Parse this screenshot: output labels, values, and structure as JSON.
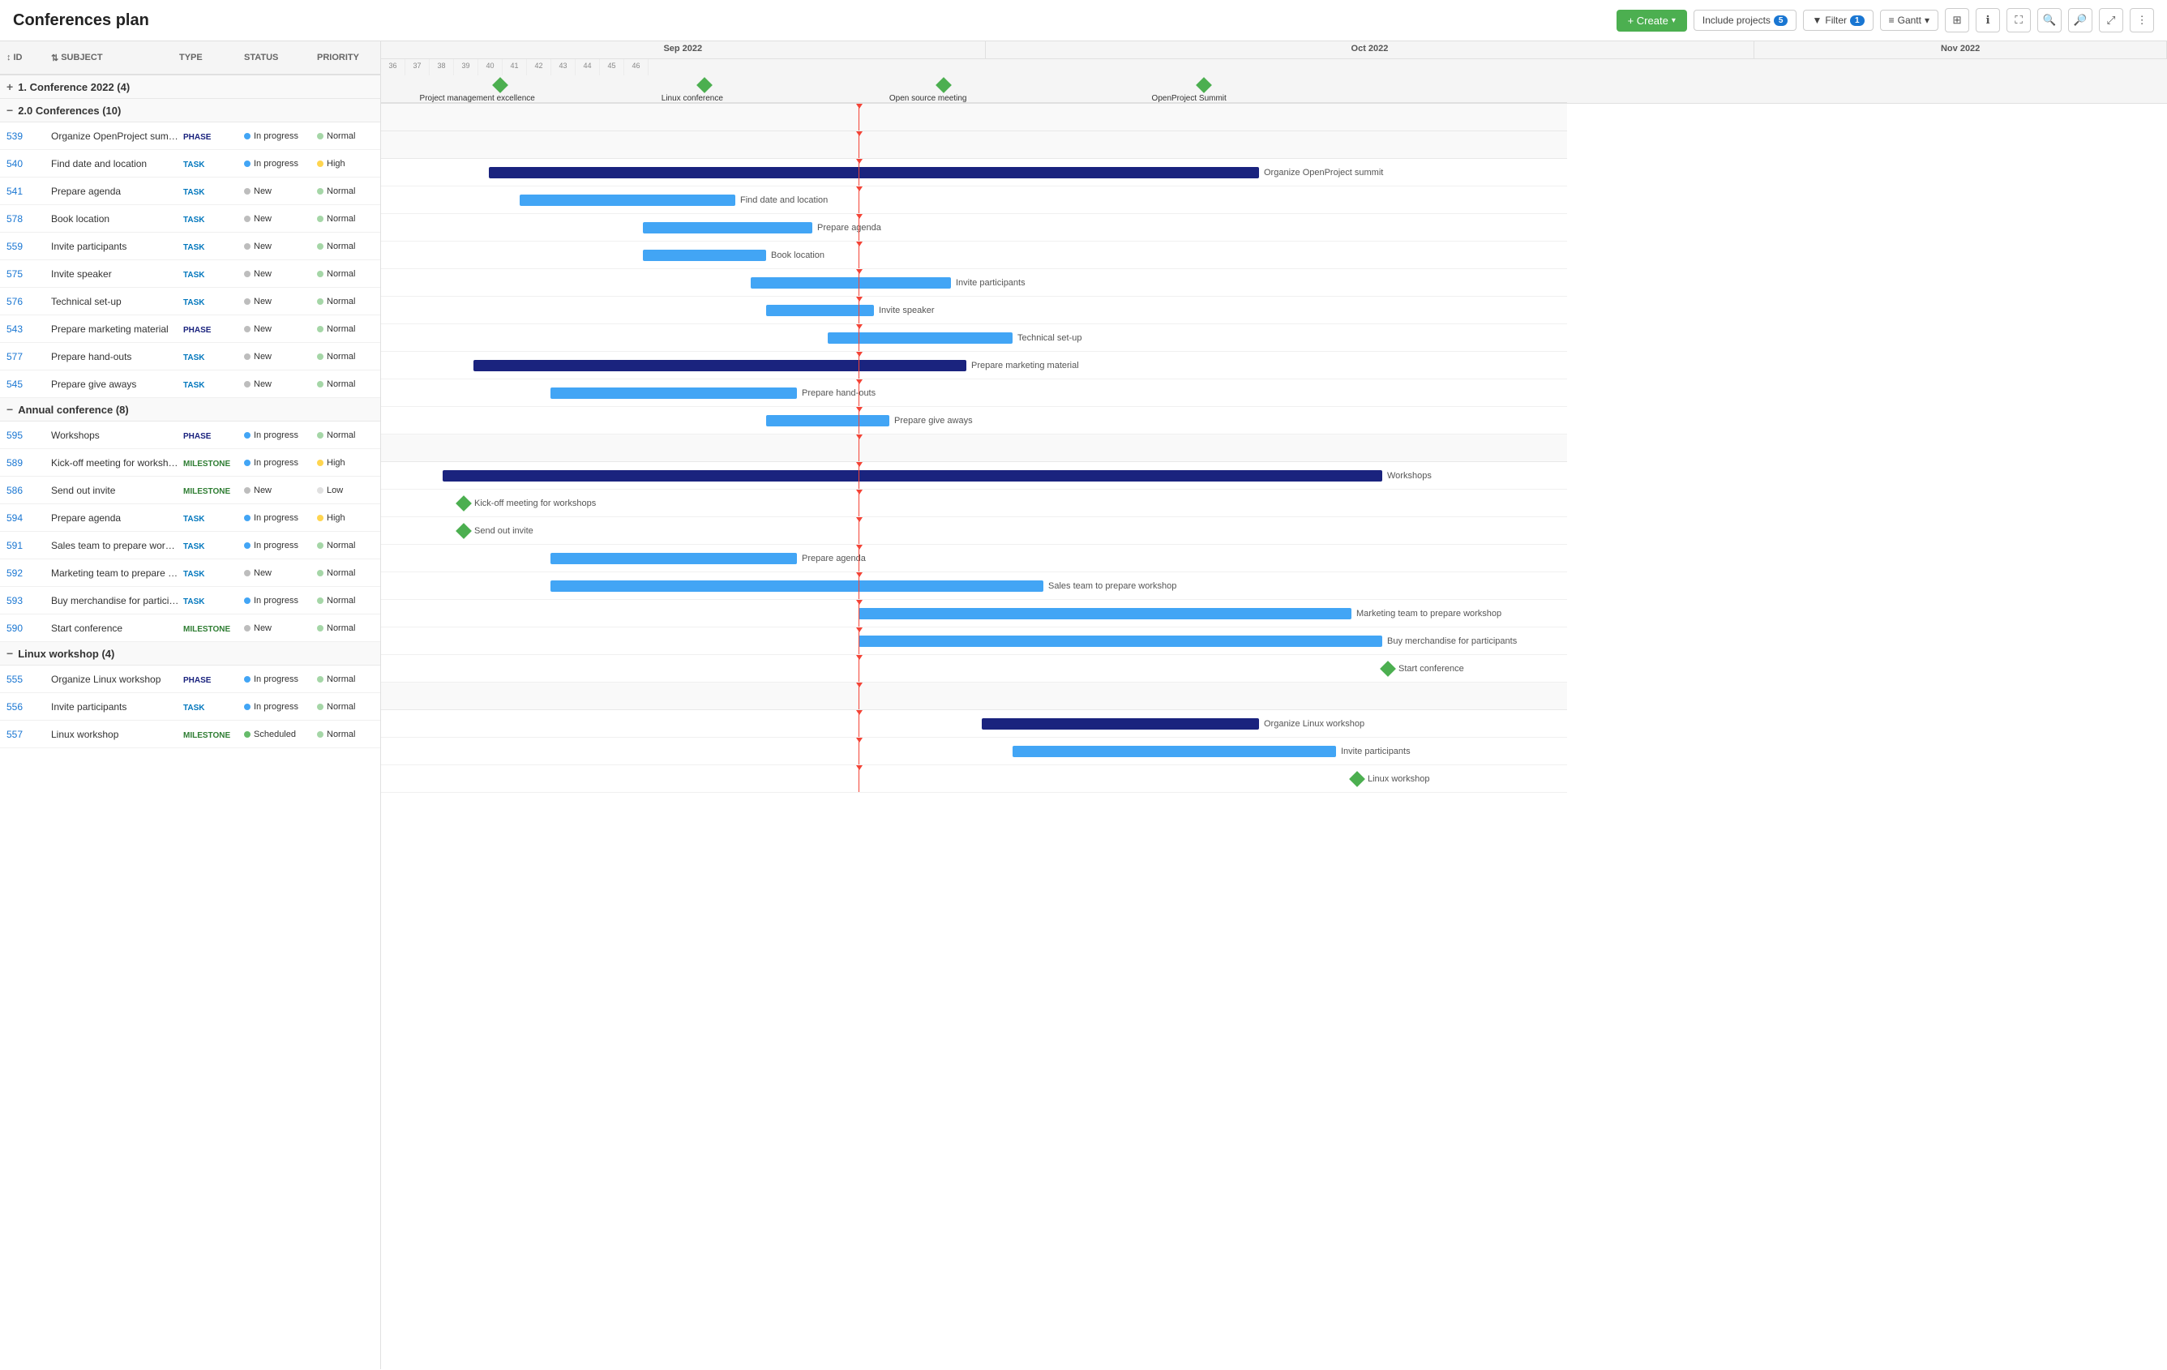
{
  "header": {
    "title": "Conferences plan",
    "create_label": "+ Create",
    "include_projects_label": "Include projects",
    "include_projects_count": "5",
    "filter_label": "Filter",
    "filter_count": "1",
    "gantt_label": "Gantt"
  },
  "columns": {
    "id": "ID",
    "subject": "SUBJECT",
    "type": "TYPE",
    "status": "STATUS",
    "priority": "PRIORITY"
  },
  "groups": [
    {
      "id": "g1",
      "label": "1. Conference 2022 (4)",
      "collapsed": true,
      "tasks": []
    },
    {
      "id": "g2",
      "label": "2.0 Conferences (10)",
      "collapsed": false,
      "tasks": [
        {
          "id": "539",
          "subject": "Organize OpenProject summit",
          "type": "PHASE",
          "type_class": "type-phase",
          "status": "In progress",
          "status_dot": "dot-inprogress",
          "priority": "Normal",
          "priority_dot": "dot-normal"
        },
        {
          "id": "540",
          "subject": "Find date and location",
          "type": "TASK",
          "type_class": "type-task",
          "status": "In progress",
          "status_dot": "dot-inprogress",
          "priority": "High",
          "priority_dot": "dot-high"
        },
        {
          "id": "541",
          "subject": "Prepare agenda",
          "type": "TASK",
          "type_class": "type-task",
          "status": "New",
          "status_dot": "dot-new",
          "priority": "Normal",
          "priority_dot": "dot-normal"
        },
        {
          "id": "578",
          "subject": "Book location",
          "type": "TASK",
          "type_class": "type-task",
          "status": "New",
          "status_dot": "dot-new",
          "priority": "Normal",
          "priority_dot": "dot-normal"
        },
        {
          "id": "559",
          "subject": "Invite participants",
          "type": "TASK",
          "type_class": "type-task",
          "status": "New",
          "status_dot": "dot-new",
          "priority": "Normal",
          "priority_dot": "dot-normal"
        },
        {
          "id": "575",
          "subject": "Invite speaker",
          "type": "TASK",
          "type_class": "type-task",
          "status": "New",
          "status_dot": "dot-new",
          "priority": "Normal",
          "priority_dot": "dot-normal"
        },
        {
          "id": "576",
          "subject": "Technical set-up",
          "type": "TASK",
          "type_class": "type-task",
          "status": "New",
          "status_dot": "dot-new",
          "priority": "Normal",
          "priority_dot": "dot-normal"
        },
        {
          "id": "543",
          "subject": "Prepare marketing material",
          "type": "PHASE",
          "type_class": "type-phase",
          "status": "New",
          "status_dot": "dot-new",
          "priority": "Normal",
          "priority_dot": "dot-normal"
        },
        {
          "id": "577",
          "subject": "Prepare hand-outs",
          "type": "TASK",
          "type_class": "type-task",
          "status": "New",
          "status_dot": "dot-new",
          "priority": "Normal",
          "priority_dot": "dot-normal"
        },
        {
          "id": "545",
          "subject": "Prepare give aways",
          "type": "TASK",
          "type_class": "type-task",
          "status": "New",
          "status_dot": "dot-new",
          "priority": "Normal",
          "priority_dot": "dot-normal"
        }
      ]
    },
    {
      "id": "g3",
      "label": "Annual conference (8)",
      "collapsed": false,
      "tasks": [
        {
          "id": "595",
          "subject": "Workshops",
          "type": "PHASE",
          "type_class": "type-phase",
          "status": "In progress",
          "status_dot": "dot-inprogress",
          "priority": "Normal",
          "priority_dot": "dot-normal"
        },
        {
          "id": "589",
          "subject": "Kick-off meeting for workshops",
          "type": "MILESTONE",
          "type_class": "type-milestone",
          "status": "In progress",
          "status_dot": "dot-inprogress",
          "priority": "High",
          "priority_dot": "dot-high"
        },
        {
          "id": "586",
          "subject": "Send out invite",
          "type": "MILESTONE",
          "type_class": "type-milestone",
          "status": "New",
          "status_dot": "dot-new",
          "priority": "Low",
          "priority_dot": "dot-low"
        },
        {
          "id": "594",
          "subject": "Prepare agenda",
          "type": "TASK",
          "type_class": "type-task",
          "status": "In progress",
          "status_dot": "dot-inprogress",
          "priority": "High",
          "priority_dot": "dot-high"
        },
        {
          "id": "591",
          "subject": "Sales team to prepare workshop",
          "type": "TASK",
          "type_class": "type-task",
          "status": "In progress",
          "status_dot": "dot-inprogress",
          "priority": "Normal",
          "priority_dot": "dot-normal"
        },
        {
          "id": "592",
          "subject": "Marketing team to prepare workshop",
          "type": "TASK",
          "type_class": "type-task",
          "status": "New",
          "status_dot": "dot-new",
          "priority": "Normal",
          "priority_dot": "dot-normal"
        },
        {
          "id": "593",
          "subject": "Buy merchandise for participants",
          "type": "TASK",
          "type_class": "type-task",
          "status": "In progress",
          "status_dot": "dot-inprogress",
          "priority": "Normal",
          "priority_dot": "dot-normal"
        },
        {
          "id": "590",
          "subject": "Start conference",
          "type": "MILESTONE",
          "type_class": "type-milestone",
          "status": "New",
          "status_dot": "dot-new",
          "priority": "Normal",
          "priority_dot": "dot-normal"
        }
      ]
    },
    {
      "id": "g4",
      "label": "Linux workshop (4)",
      "collapsed": false,
      "tasks": [
        {
          "id": "555",
          "subject": "Organize Linux workshop",
          "type": "PHASE",
          "type_class": "type-phase",
          "status": "In progress",
          "status_dot": "dot-inprogress",
          "priority": "Normal",
          "priority_dot": "dot-normal"
        },
        {
          "id": "556",
          "subject": "Invite participants",
          "type": "TASK",
          "type_class": "type-task",
          "status": "In progress",
          "status_dot": "dot-inprogress",
          "priority": "Normal",
          "priority_dot": "dot-normal"
        },
        {
          "id": "557",
          "subject": "Linux workshop",
          "type": "MILESTONE",
          "type_class": "type-milestone",
          "status": "Scheduled",
          "status_dot": "dot-scheduled",
          "priority": "Normal",
          "priority_dot": "dot-normal"
        }
      ]
    }
  ],
  "gantt": {
    "months": [
      "Sep 2022",
      "Oct 2022",
      "Nov 2022"
    ],
    "today_line_pct": 42
  }
}
